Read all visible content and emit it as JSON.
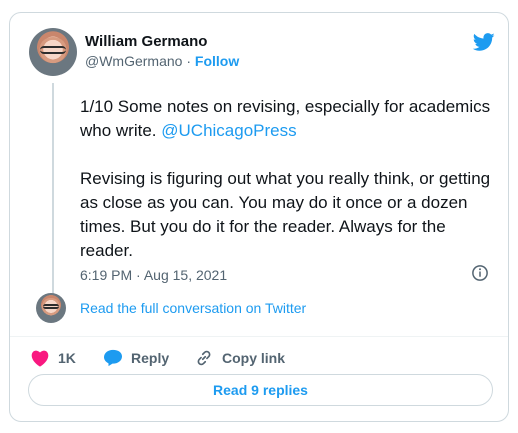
{
  "author": {
    "name": "William Germano",
    "handle": "@WmGermano",
    "separator": "·",
    "follow_label": "Follow"
  },
  "tweet": {
    "paragraph1_text": "1/10 Some notes on revising, especially for academics who write.",
    "mention": "@UChicagoPress",
    "paragraph2": "Revising is figuring out what you really think, or getting as close as you can. You may do it once or a dozen times. But you do it for the reader. Always for the reader.",
    "time": "6:19 PM",
    "date_separator": "·",
    "date": "Aug 15, 2021"
  },
  "conversation": {
    "link_label": "Read the full conversation on Twitter"
  },
  "actions": {
    "like_count": "1K",
    "reply_label": "Reply",
    "copy_label": "Copy link"
  },
  "footer": {
    "read_replies_label": "Read 9 replies"
  },
  "icons": {
    "brand": "twitter-bird-icon",
    "info": "info-icon",
    "like": "heart-icon",
    "reply": "reply-bubble-icon",
    "copy": "link-icon"
  },
  "colors": {
    "accent": "#1d9bf0",
    "like": "#f91880",
    "text": "#0f1419",
    "muted": "#536471",
    "border": "#cfd9de"
  }
}
